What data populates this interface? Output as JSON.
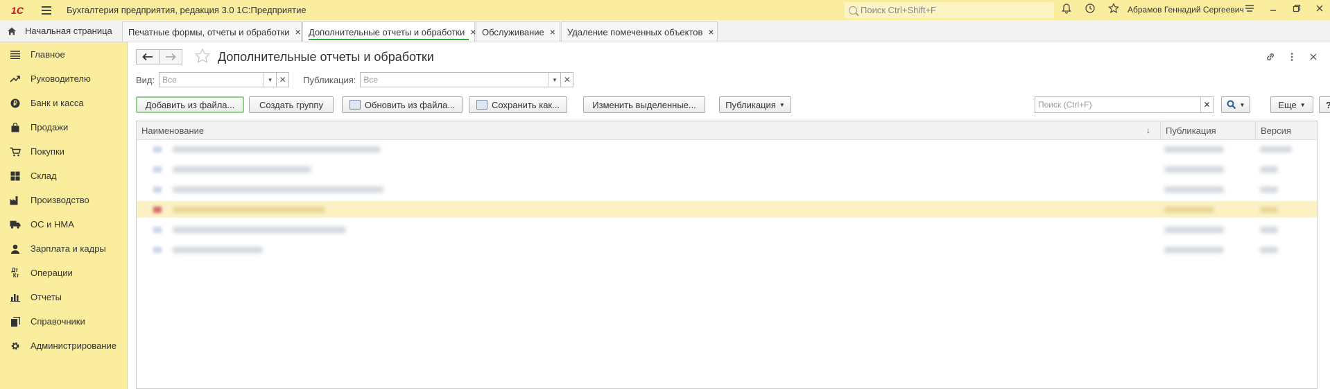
{
  "app": {
    "logo": "1С",
    "title": "Бухгалтерия предприятия, редакция 3.0 1С:Предприятие",
    "search_placeholder": "Поиск Ctrl+Shift+F",
    "user": "Абрамов Геннадий Сергеевич"
  },
  "tabs": {
    "home": "Начальная страница",
    "items": [
      {
        "label": "Печатные формы, отчеты и обработки"
      },
      {
        "label": "Дополнительные отчеты и обработки"
      },
      {
        "label": "Обслуживание"
      },
      {
        "label": "Удаление помеченных объектов"
      }
    ],
    "close_glyph": "×"
  },
  "sidebar": {
    "items": [
      {
        "label": "Главное",
        "icon": "menu-icon"
      },
      {
        "label": "Руководителю",
        "icon": "trend-icon"
      },
      {
        "label": "Банк и касса",
        "icon": "ruble-icon"
      },
      {
        "label": "Продажи",
        "icon": "bag-icon"
      },
      {
        "label": "Покупки",
        "icon": "cart-icon"
      },
      {
        "label": "Склад",
        "icon": "warehouse-icon"
      },
      {
        "label": "Производство",
        "icon": "factory-icon"
      },
      {
        "label": "ОС и НМА",
        "icon": "truck-icon"
      },
      {
        "label": "Зарплата и кадры",
        "icon": "person-icon"
      },
      {
        "label": "Операции",
        "icon": "dt-kt-icon"
      },
      {
        "label": "Отчеты",
        "icon": "bar-chart-icon"
      },
      {
        "label": "Справочники",
        "icon": "books-icon"
      },
      {
        "label": "Администрирование",
        "icon": "gear-icon"
      }
    ]
  },
  "main": {
    "title": "Дополнительные отчеты и обработки",
    "filters": {
      "view_label": "Вид:",
      "view_value": "Все",
      "publication_label": "Публикация:",
      "publication_value": "Все"
    },
    "toolbar": {
      "add_from_file": "Добавить из файла...",
      "create_group": "Создать группу",
      "update_from_file": "Обновить из файла...",
      "save_as": "Сохранить как...",
      "change_selected": "Изменить выделенные...",
      "publication": "Публикация",
      "search_placeholder": "Поиск (Ctrl+F)",
      "more": "Еще",
      "help": "?"
    },
    "table": {
      "columns": [
        "Наименование",
        "Публикация",
        "Версия"
      ],
      "sort_glyph": "↓"
    }
  },
  "colors": {
    "header_bg": "#fbed9e",
    "accent_green": "#35a838",
    "selected_row": "#fcf1c5"
  }
}
